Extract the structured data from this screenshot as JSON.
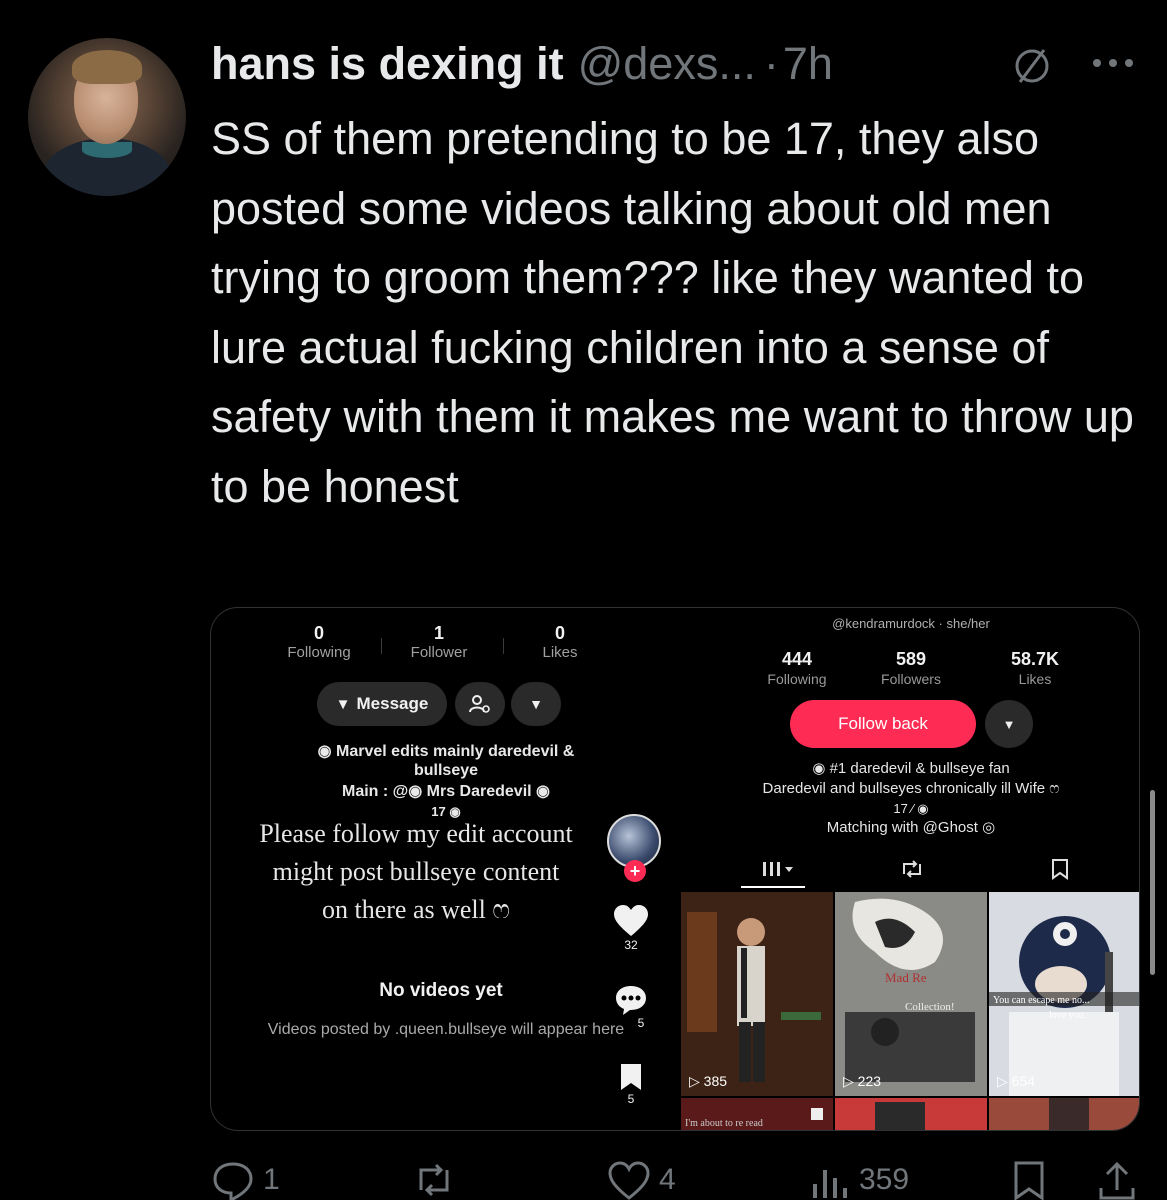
{
  "tweet": {
    "display_name": "hans is dexing it",
    "handle": "@dexs...",
    "separator": "·",
    "time": "7h",
    "text": "SS of them pretending to be 17, they also posted some videos talking about old men trying to groom them??? like they wanted to lure actual fucking children into a sense of safety with them it makes me want to throw up to be honest"
  },
  "left_profile": {
    "stats": [
      {
        "num": "0",
        "label": "Following"
      },
      {
        "num": "1",
        "label": "Follower"
      },
      {
        "num": "0",
        "label": "Likes"
      }
    ],
    "message_label": "Message",
    "bio_lines": [
      "◉ Marvel edits mainly daredevil &",
      "bullseye",
      "Main : @◉ Mrs Daredevil ◉",
      "17 ◉"
    ],
    "caption_lines": [
      "Please follow my edit account",
      "might post bullseye content",
      "on there as well ෆ"
    ],
    "rail": {
      "likes": "32",
      "comments": "5",
      "saves": "5"
    },
    "empty_title": "No videos yet",
    "empty_sub": "Videos posted by .queen.bullseye will appear here"
  },
  "right_profile": {
    "top_handle": "@kendramurdock · she/her",
    "stats": [
      {
        "num": "444",
        "label": "Following"
      },
      {
        "num": "589",
        "label": "Followers"
      },
      {
        "num": "58.7K",
        "label": "Likes"
      }
    ],
    "follow_label": "Follow back",
    "bio_lines": [
      "◉ #1 daredevil & bullseye fan",
      "Daredevil and bullseyes chronically ill Wife ෆ",
      "17 ⁄ ◉",
      "Matching with @Ghost ◎"
    ],
    "videos": [
      {
        "views": "385"
      },
      {
        "views": "223",
        "overlay": "Mad Re Collection!"
      },
      {
        "views": "654",
        "overlay": "You can escape me mo... love you."
      }
    ],
    "row2_overlay": "I'm about to re read"
  },
  "actions": {
    "replies": "1",
    "retweets": "",
    "likes": "4",
    "views": "359"
  },
  "colors": {
    "background": "#000000",
    "text": "#e7e9ea",
    "muted": "#71767b",
    "tiktok_red": "#fe2c55"
  }
}
